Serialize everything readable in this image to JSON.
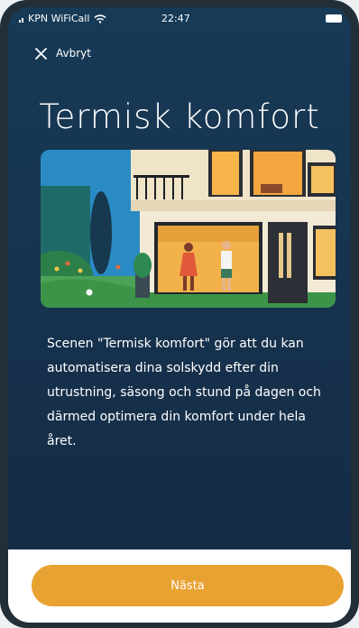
{
  "statusbar": {
    "carrier": "KPN WiFiCall",
    "time": "22:47"
  },
  "header": {
    "close_label": "Avbryt"
  },
  "main": {
    "title": "Termisk komfort",
    "description": "Scenen \"Termisk komfort\" gör att du kan automatisera dina solskydd efter din utrustning, säsong och stund på dagen och därmed optimera din komfort under hela året."
  },
  "footer": {
    "next_label": "Nästa"
  },
  "colors": {
    "background": "#173a56",
    "accent": "#e8a232",
    "text": "#ffffff"
  }
}
